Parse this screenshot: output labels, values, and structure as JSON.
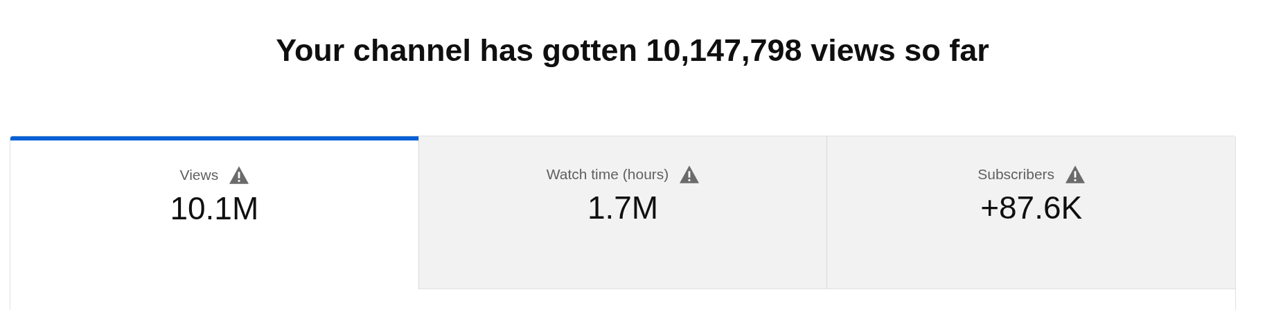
{
  "title": "Your channel has gotten 10,147,798 views so far",
  "tabs": [
    {
      "label": "Views",
      "value": "10.1M",
      "selected": true,
      "warning": true
    },
    {
      "label": "Watch time (hours)",
      "value": "1.7M",
      "selected": false,
      "warning": true
    },
    {
      "label": "Subscribers",
      "value": "+87.6K",
      "selected": false,
      "warning": true
    }
  ]
}
